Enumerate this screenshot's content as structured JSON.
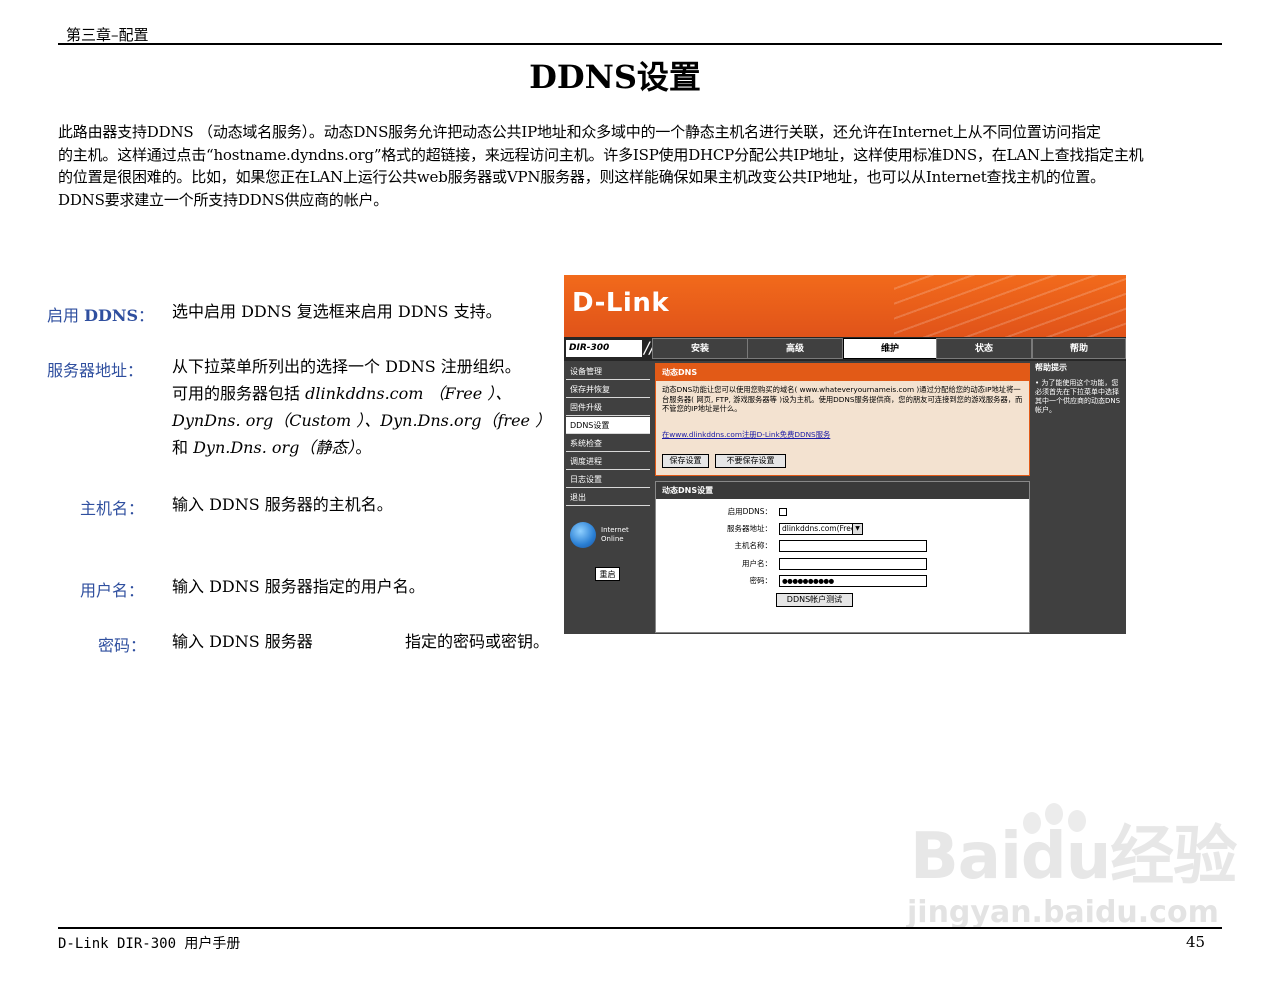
{
  "header": {
    "chapter": "第三章–配置"
  },
  "title": "DDNS设置",
  "intro": [
    "此路由器支持DDNS （动态域名服务）。动态DNS服务允许把动态公共IP地址和众多域中的一个静态主机名进行关联，还允许在Internet上从不同位置访问指定",
    "的主机。这样通过点击“hostname.dyndns.org”格式的超链接，来远程访问主机。许多ISP使用DHCP分配公共IP地址，这样使用标准DNS，在LAN上查找指定主机",
    "的位置是很困难的。比如，如果您正在LAN上运行公共web服务器或VPN服务器，则这样能确保如果主机改变公共IP地址，也可以从Internet查找主机的位置。",
    "DDNS要求建立一个所支持DDNS供应商的帐户。"
  ],
  "definitions": {
    "enable": {
      "label_prefix": "启用 ",
      "label_bold": "DDNS",
      "label_suffix": "：",
      "text": "选中启用 DDNS 复选框来启用 DDNS 支持。"
    },
    "server": {
      "label": "服务器地址：",
      "line1": "从下拉菜单所列出的选择一个 DDNS 注册组织。",
      "line2_a": "可用的服务器包括 ",
      "line2_b": "dlinkddns.com （Free ）、",
      "line3": "DynDns. org（Custom ）、Dyn.Dns.org（free ）",
      "line4_a": "和 ",
      "line4_b": "Dyn.Dns. org（静态）",
      "line4_c": "。"
    },
    "host": {
      "label": "主机名：",
      "text": "输入 DDNS 服务器的主机名。"
    },
    "user": {
      "label": "用户名：",
      "text": "输入 DDNS 服务器指定的用户名。"
    },
    "password": {
      "label": "密码：",
      "text_a": "输入 DDNS 服务器",
      "text_b": "指定的密码或密钥。"
    }
  },
  "router": {
    "logo": "D-Link",
    "model": "DIR-300",
    "tabs": [
      "安装",
      "高级",
      "维护",
      "状态",
      "帮助"
    ],
    "active_tab": 2,
    "nav": [
      "设备管理",
      "保存并恢复",
      "固件升级",
      "DDNS设置",
      "系统检查",
      "调度进程",
      "日志设置",
      "退出"
    ],
    "active_nav": 3,
    "internet_label": "Internet",
    "online_label": "Online",
    "reboot": "重启",
    "box1_title": "动态DNS",
    "box1_text": "动态DNS功能让您可以使用您购买的域名( www.whateveryournameis.com )通过分配给您的动态IP地址将一台服务器( 网页, FTP, 游戏服务器等 )设为主机。使用DDNS服务提供商，您的朋友可连接到您的游戏服务器，而不管您的IP地址是什么。",
    "box1_link": "在www.dlinkddns.com注册D-Link免费DDNS服务",
    "save_btn": "保存设置",
    "nosave_btn": "不要保存设置",
    "box2_title": "动态DNS设置",
    "enable_label": "启用DDNS：",
    "server_label": "服务器地址：",
    "server_value": "dlinkddns.com(Free)",
    "host_label": "主机名称：",
    "user_label": "用户名：",
    "pwd_label": "密码：",
    "pwd_value": "●●●●●●●●●●",
    "test_btn": "DDNS帐户测试",
    "help_title": "帮助提示",
    "help_text": "• 为了能使用这个功能，您必须首先在下拉菜单中选择其中一个供应商的动态DNS帐户。",
    "arrow_glyph": "▼"
  },
  "footer": {
    "left": "D-Link DIR-300 用户手册",
    "page": "45"
  },
  "watermark": {
    "brand": "Baidu经验",
    "url": "jingyan.baidu.com"
  },
  "colors": {
    "label_blue": "#2f4f9f",
    "dlink_orange": "#e25a17",
    "nav_dark": "#404040"
  }
}
